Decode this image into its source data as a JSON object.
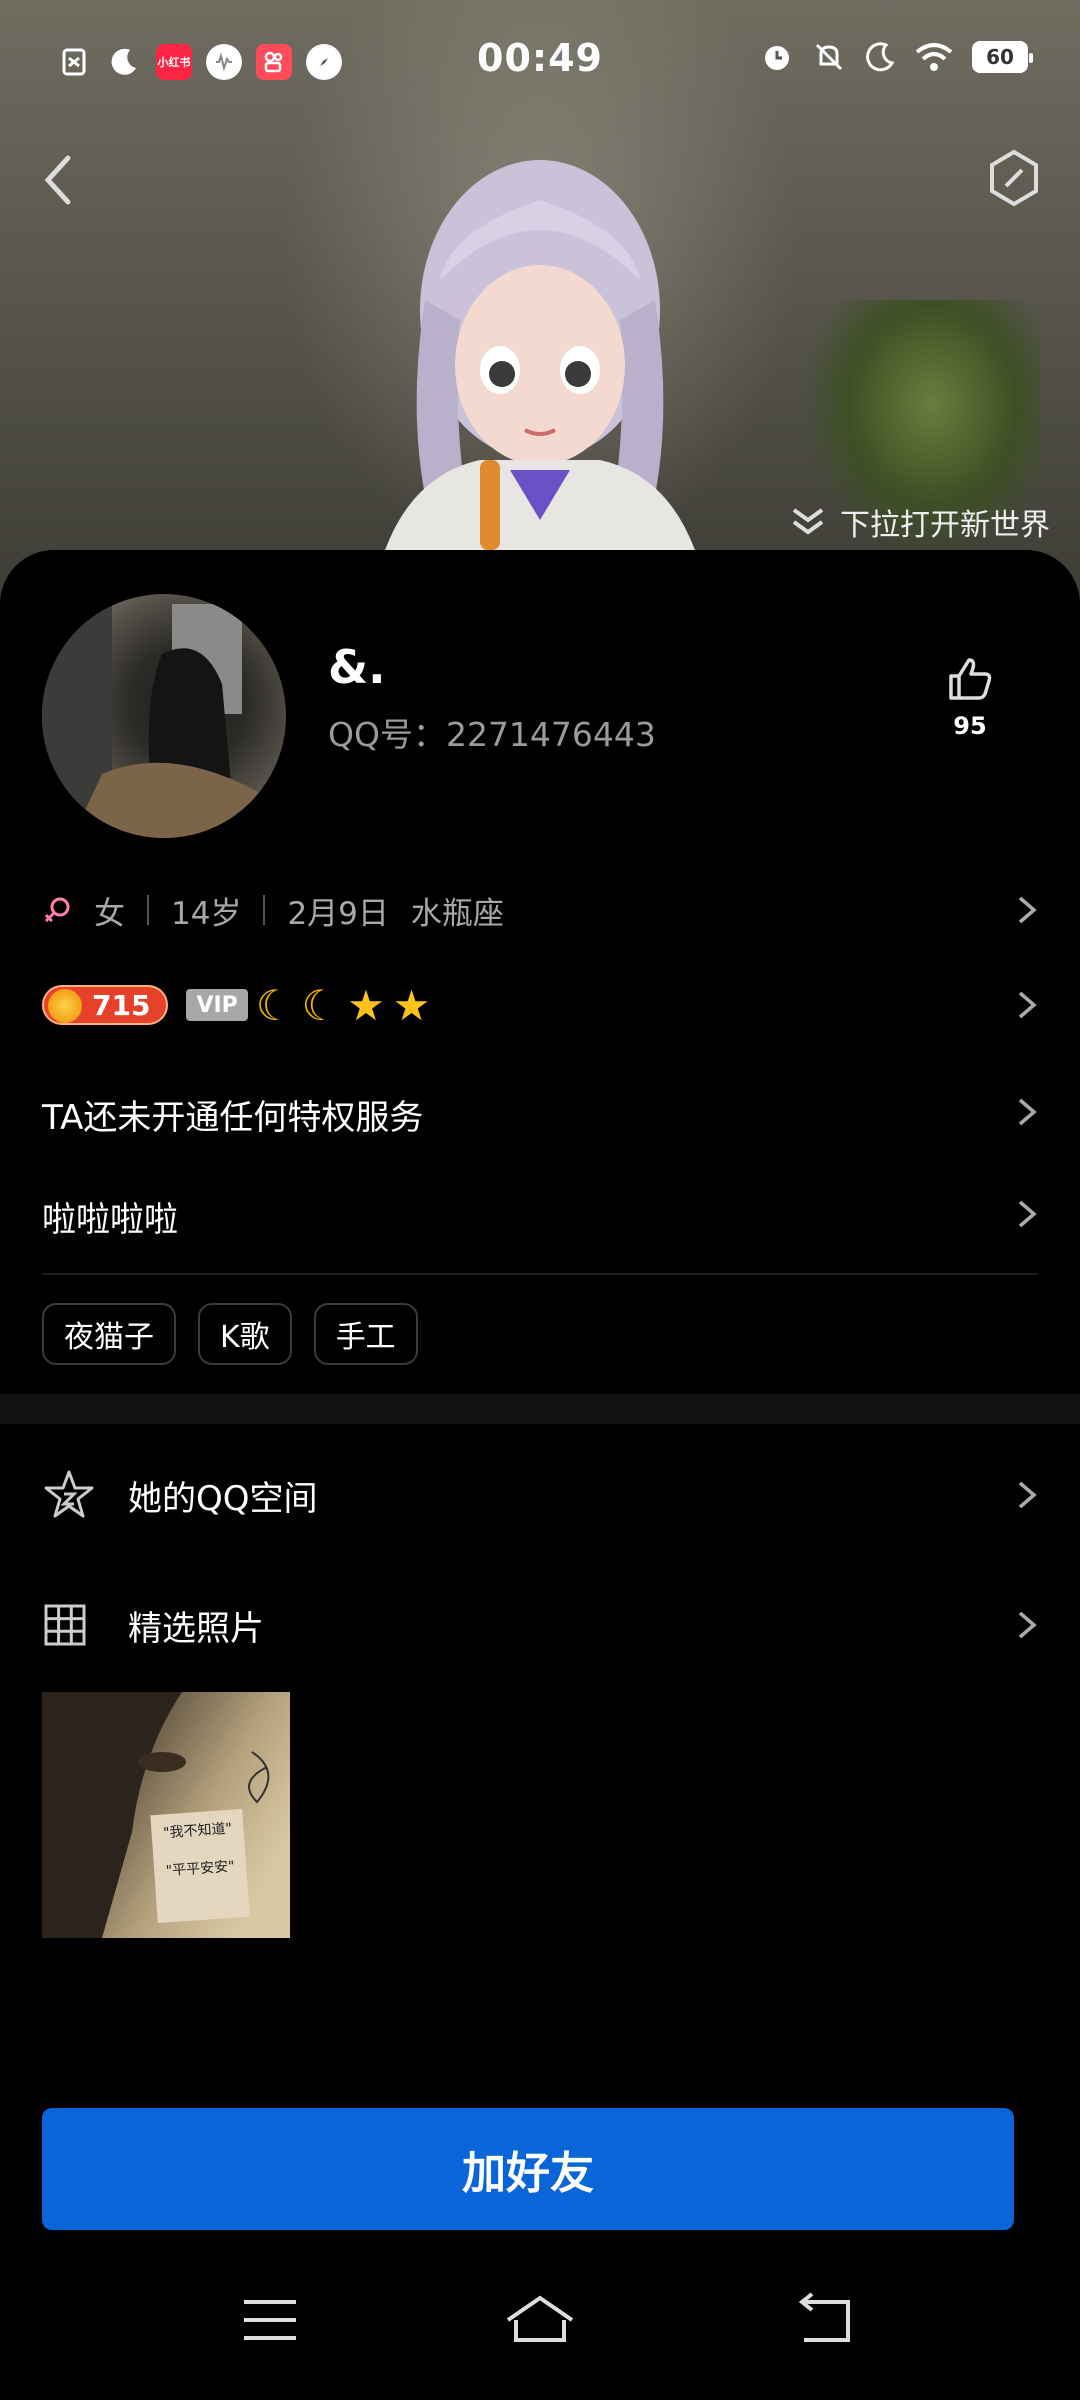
{
  "status_bar": {
    "time": "00:49",
    "battery": "60",
    "left_icons": [
      "sim-off-icon",
      "moon-icon",
      "xiaohongshu-icon",
      "voice-app-icon",
      "kuaishou-icon",
      "compass-icon"
    ],
    "xiaohongshu_text": "小红书",
    "right_icons": [
      "alarm-icon",
      "mute-icon",
      "dnd-moon-icon",
      "wifi-icon",
      "battery-icon"
    ]
  },
  "hero": {
    "pull_hint": "下拉打开新世界"
  },
  "profile": {
    "nickname": "&.",
    "qq_number": "QQ号：2271476443",
    "likes": "95",
    "gender": "女",
    "age": "14岁",
    "birthday": "2月9日",
    "zodiac": "水瓶座",
    "level": "715",
    "vip": "VIP",
    "privilege_text": "TA还未开通任何特权服务",
    "signature": "啦啦啦啦",
    "tags": [
      "夜猫子",
      "K歌",
      "手工"
    ]
  },
  "sections": {
    "qzone": "她的QQ空间",
    "photos": "精选照片"
  },
  "photo_note": {
    "line1": "\"我不知道\"",
    "line2": "\"平平安安\""
  },
  "actions": {
    "add_friend": "加好友"
  },
  "colors": {
    "accent": "#0a66d8",
    "background": "#000000",
    "female_symbol": "#ff7fb0"
  }
}
